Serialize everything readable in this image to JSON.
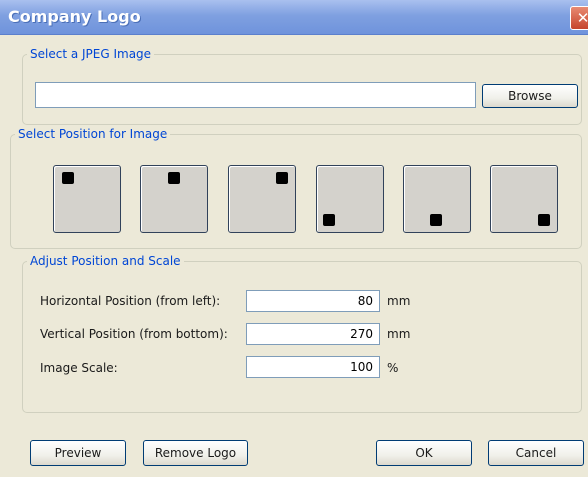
{
  "window": {
    "title": "Company Logo",
    "close_glyph": "✕"
  },
  "file_group": {
    "legend": "Select a JPEG Image",
    "path_value": "",
    "browse_label": "Browse"
  },
  "position_group": {
    "legend": "Select Position for Image",
    "options": [
      {
        "name": "top-left"
      },
      {
        "name": "top-center"
      },
      {
        "name": "top-right"
      },
      {
        "name": "bottom-left"
      },
      {
        "name": "bottom-center"
      },
      {
        "name": "bottom-right"
      }
    ]
  },
  "adjust_group": {
    "legend": "Adjust Position and Scale",
    "horizontal": {
      "label": "Horizontal Position (from left):",
      "value": "80",
      "unit": "mm"
    },
    "vertical": {
      "label": "Vertical Position (from bottom):",
      "value": "270",
      "unit": "mm"
    },
    "scale": {
      "label": "Image Scale:",
      "value": "100",
      "unit": "%"
    }
  },
  "buttons": {
    "preview": "Preview",
    "remove_logo": "Remove Logo",
    "ok": "OK",
    "cancel": "Cancel"
  },
  "colors": {
    "title_bar": "#7fa0e0",
    "legend_text": "#0046d5",
    "dialog_bg": "#ece9d8"
  }
}
